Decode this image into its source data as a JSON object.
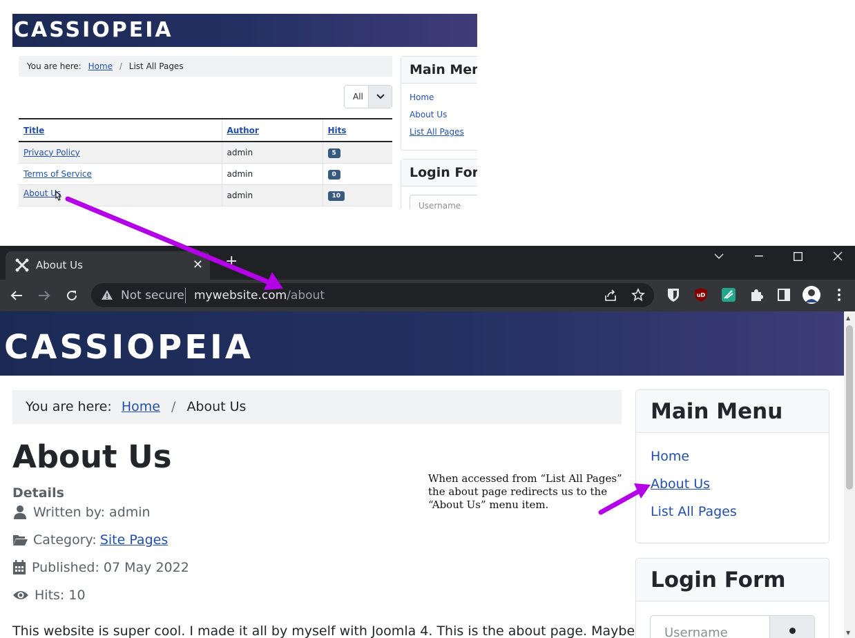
{
  "inset": {
    "logo": "CASSIOPEIA",
    "breadcrumb": {
      "prefix": "You are here:",
      "home": "Home",
      "current": "List All Pages"
    },
    "filter": {
      "value": "All"
    },
    "table": {
      "headers": [
        "Title",
        "Author",
        "Hits"
      ],
      "rows": [
        {
          "title": "Privacy Policy",
          "author": "admin",
          "hits": "5"
        },
        {
          "title": "Terms of Service",
          "author": "admin",
          "hits": "0"
        },
        {
          "title": "About Us",
          "author": "admin",
          "hits": "10"
        }
      ]
    },
    "main_menu": {
      "title": "Main Men",
      "items": [
        "Home",
        "About Us",
        "List All Pages"
      ]
    },
    "login": {
      "title": "Login Forr",
      "username_placeholder": "Username"
    }
  },
  "browser": {
    "tab_title": "About Us",
    "address": {
      "security": "Not secure",
      "host": "mywebsite.com",
      "path": "/about"
    }
  },
  "page": {
    "logo": "CASSIOPEIA",
    "breadcrumb": {
      "prefix": "You are here:",
      "home": "Home",
      "current": "About Us"
    },
    "title": "About Us",
    "details_label": "Details",
    "meta": {
      "author": "Written by: admin",
      "category_label": "Category:",
      "category": "Site Pages",
      "published": "Published: 07 May 2022",
      "hits": "Hits: 10"
    },
    "body": "This website is super cool. I made it all by myself with Joomla 4. This is the about page. Maybe I will",
    "main_menu": {
      "title": "Main Menu",
      "items": [
        "Home",
        "About Us",
        "List All Pages"
      ],
      "active_index": 1
    },
    "login": {
      "title": "Login Form",
      "username_placeholder": "Username"
    }
  },
  "annotation": {
    "lines": [
      "When accessed from “List All Pages”",
      "the about page redirects us to the",
      "“About Us” menu item."
    ]
  },
  "colors": {
    "arrow": "#b400e6",
    "link": "#224faa",
    "header_start": "#1b2a55",
    "header_end": "#3e3d77"
  }
}
